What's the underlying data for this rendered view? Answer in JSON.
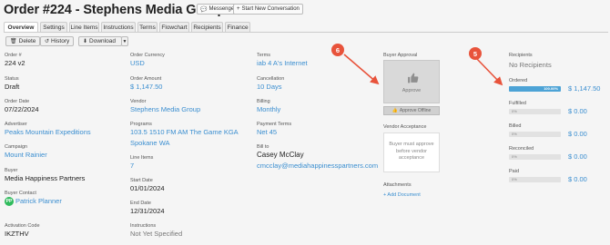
{
  "header": {
    "title": "Order #224 - Stephens Media Group",
    "messenger_label": "Messenger",
    "new_conversation_label": "Start New Conversation"
  },
  "tabs": [
    "Overview",
    "Settings",
    "Line Items",
    "Instructions",
    "Terms",
    "Flowchart",
    "Recipients",
    "Finance"
  ],
  "toolbar": {
    "delete_label": "Delete",
    "history_label": "History",
    "download_label": "Download"
  },
  "fields": {
    "order_num": {
      "label": "Order #",
      "value": "224 v2"
    },
    "status": {
      "label": "Status",
      "value": "Draft"
    },
    "order_date": {
      "label": "Order Date",
      "value": "07/22/2024"
    },
    "advertiser": {
      "label": "Advertiser",
      "value": "Peaks Mountain Expeditions"
    },
    "campaign": {
      "label": "Campaign",
      "value": "Mount Rainier"
    },
    "buyer": {
      "label": "Buyer",
      "value": "Media Happiness Partners"
    },
    "buyer_contact": {
      "label": "Buyer Contact",
      "initials": "PP",
      "value": "Patrick Planner"
    },
    "activation_code": {
      "label": "Activation Code",
      "value": "IKZTHV"
    },
    "currency": {
      "label": "Order Currency",
      "value": "USD"
    },
    "amount": {
      "label": "Order Amount",
      "value": "$ 1,147.50"
    },
    "vendor": {
      "label": "Vendor",
      "value": "Stephens Media Group"
    },
    "programs": {
      "label": "Programs",
      "line1": "103.5 1510 FM AM The Game KGA",
      "line2": "Spokane WA"
    },
    "line_items": {
      "label": "Line Items",
      "value": "7"
    },
    "start_date": {
      "label": "Start Date",
      "value": "01/01/2024"
    },
    "end_date": {
      "label": "End Date",
      "value": "12/31/2024"
    },
    "instructions": {
      "label": "Instructions",
      "value": "Not Yet Specified"
    },
    "terms": {
      "label": "Terms",
      "value": "iab 4 A's Internet"
    },
    "cancellation": {
      "label": "Cancellation",
      "value": "10 Days"
    },
    "billing": {
      "label": "Billing",
      "value": "Monthly"
    },
    "payment_terms": {
      "label": "Payment Terms",
      "value": "Net 45"
    },
    "bill_to": {
      "label": "Bill to",
      "name": "Casey McClay",
      "email": "cmcclay@mediahappinesspartners.com"
    }
  },
  "approval": {
    "label": "Buyer Approval",
    "approve_label": "Approve",
    "offline_label": "Approve Offline",
    "vendor_acceptance_label": "Vendor Acceptance",
    "vendor_acceptance_text": "Buyer must approve before vendor acceptance",
    "attachments_label": "Attachments",
    "add_document_label": "+ Add Document"
  },
  "recipients": {
    "label": "Recipients",
    "value": "No Recipients"
  },
  "finance": [
    {
      "label": "Ordered",
      "percent_text": "100.00%",
      "fraction": 1.0,
      "amount": "$ 1,147.50"
    },
    {
      "label": "Fulfilled",
      "percent_text": "0%",
      "fraction": 0,
      "amount": "$ 0.00"
    },
    {
      "label": "Billed",
      "percent_text": "0%",
      "fraction": 0,
      "amount": "$ 0.00"
    },
    {
      "label": "Reconciled",
      "percent_text": "0%",
      "fraction": 0,
      "amount": "$ 0.00"
    },
    {
      "label": "Paid",
      "percent_text": "0%",
      "fraction": 0,
      "amount": "$ 0.00"
    }
  ],
  "callouts": [
    "6",
    "5"
  ],
  "colors": {
    "link": "#3a8ed0",
    "callout": "#e8533b",
    "progress": "#4da3d6",
    "avatar": "#2fbb5c"
  }
}
